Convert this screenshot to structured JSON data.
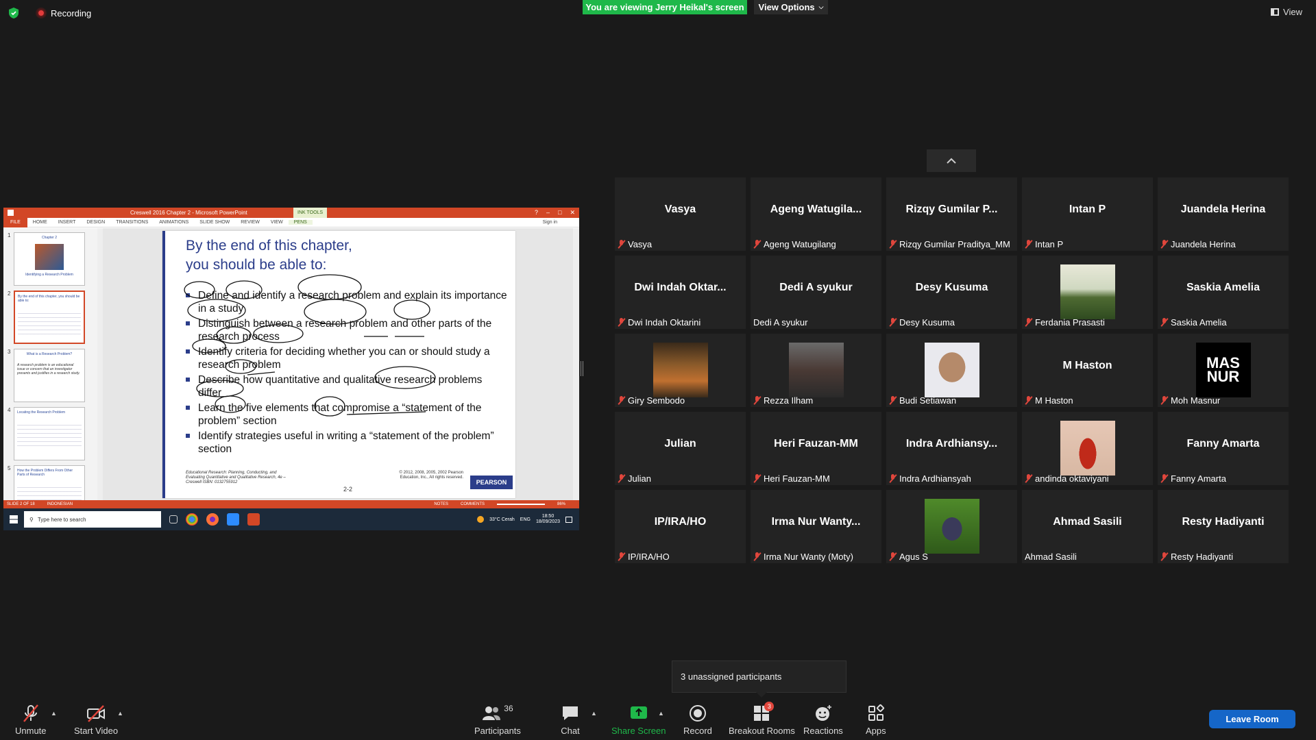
{
  "topbar": {
    "recording_label": "Recording",
    "viewing_banner": "You are viewing Jerry Heikal's screen",
    "view_options": "View Options",
    "view_label": "View"
  },
  "powerpoint": {
    "window_title": "Creswell 2016 Chapter 2 - Microsoft PowerPoint",
    "ink_tools": "INK TOOLS",
    "sign_in": "Sign in",
    "tabs": [
      "FILE",
      "HOME",
      "INSERT",
      "DESIGN",
      "TRANSITIONS",
      "ANIMATIONS",
      "SLIDE SHOW",
      "REVIEW",
      "VIEW",
      "PENS"
    ],
    "thumb_numbers": [
      "1",
      "2",
      "3",
      "4",
      "5"
    ],
    "thumbs": [
      {
        "title": "Chapter 2",
        "subtitle": "Identifying a Research Problem"
      },
      {
        "title": "By the end of this chapter, you should be able to:"
      },
      {
        "title": "What is a Research Problem?",
        "body": "A research problem is an educational issue or concern that an investigator presents and justifies in a research study."
      },
      {
        "title": "Locating the Research Problem"
      },
      {
        "title": "How the Problem Differs From Other Parts of Research"
      }
    ],
    "slide": {
      "title_line1": "By the end of this chapter,",
      "title_line2": "you should be able to:",
      "bullets": [
        "Define and identify a research problem and explain its importance in a study",
        "Distinguish between a research problem and other parts of the research process",
        "Identify criteria for deciding whether you can or should study a research problem",
        "Describe how quantitative and qualitative research problems differ",
        "Learn the five elements that compromise a “statement of the problem” section",
        "Identify strategies useful in writing a “statement of the problem” section"
      ],
      "footer_left": "Educational Research: Planning, Conducting, and Evaluating Quantitative and Qualitative Research, 4e – Creswell  ISBN: 0132755912",
      "page_number": "2-2",
      "footer_right": "© 2012, 2008, 2005, 2002 Pearson Education, Inc., All rights reserved.",
      "publisher": "PEARSON"
    },
    "status": {
      "slide_of": "SLIDE 2 OF 18",
      "language": "INDONESIAN",
      "notes": "NOTES",
      "comments": "COMMENTS",
      "zoom": "86%"
    },
    "taskbar": {
      "search_placeholder": "Type here to search",
      "weather": "33°C  Cerah",
      "lang": "ENG",
      "time": "18:50",
      "date": "18/09/2023"
    }
  },
  "participants": [
    {
      "big": "Vasya",
      "label": "Vasya",
      "muted": true
    },
    {
      "big": "Ageng Watugila...",
      "label": "Ageng Watugilang",
      "muted": true
    },
    {
      "big": "Rizqy Gumilar P...",
      "label": "Rizqy Gumilar Praditya_MM",
      "muted": true
    },
    {
      "big": "Intan P",
      "label": "Intan P",
      "muted": true
    },
    {
      "big": "Juandela Herina",
      "label": "Juandela Herina",
      "muted": true
    },
    {
      "big": "Dwi Indah Oktar...",
      "label": "Dwi Indah Oktarini",
      "muted": true
    },
    {
      "big": "Dedi A syukur",
      "label": "Dedi A syukur",
      "muted": false
    },
    {
      "big": "Desy Kusuma",
      "label": "Desy Kusuma",
      "muted": true
    },
    {
      "big": "",
      "label": "Ferdania Prasasti",
      "muted": true,
      "photo": "landscape"
    },
    {
      "big": "Saskia Amelia",
      "label": "Saskia Amelia",
      "muted": true
    },
    {
      "big": "",
      "label": "Giry Sembodo",
      "muted": true,
      "photo": "room"
    },
    {
      "big": "",
      "label": "Rezza Ilham",
      "muted": true,
      "photo": "piano"
    },
    {
      "big": "",
      "label": "Budi Setiawan",
      "muted": true,
      "photo": "mask"
    },
    {
      "big": "M Haston",
      "label": "M Haston",
      "muted": true
    },
    {
      "big": "",
      "label": "Moh Masnur",
      "muted": true,
      "photo": "logo",
      "logo_text": "MAS NUR"
    },
    {
      "big": "Julian",
      "label": "Julian",
      "muted": true
    },
    {
      "big": "Heri Fauzan-MM",
      "label": "Heri Fauzan-MM",
      "muted": true
    },
    {
      "big": "Indra Ardhiansy...",
      "label": "Indra Ardhiansyah",
      "muted": true
    },
    {
      "big": "",
      "label": "andinda oktaviyani",
      "muted": true,
      "photo": "girl"
    },
    {
      "big": "Fanny Amarta",
      "label": "Fanny Amarta",
      "muted": true
    },
    {
      "big": "IP/IRA/HO",
      "label": "IP/IRA/HO",
      "muted": true
    },
    {
      "big": "Irma Nur Wanty...",
      "label": "Irma Nur Wanty (Moty)",
      "muted": true
    },
    {
      "big": "",
      "label": "Agus S",
      "muted": true,
      "photo": "bike"
    },
    {
      "big": "Ahmad Sasili",
      "label": "Ahmad Sasili",
      "muted": false
    },
    {
      "big": "Resty Hadiyanti",
      "label": "Resty Hadiyanti",
      "muted": true
    }
  ],
  "unassigned": "3 unassigned participants",
  "toolbar": {
    "unmute": "Unmute",
    "start_video": "Start Video",
    "participants": "Participants",
    "participant_count": "36",
    "chat": "Chat",
    "share_screen": "Share Screen",
    "record": "Record",
    "breakout_rooms": "Breakout Rooms",
    "breakout_badge": "3",
    "reactions": "Reactions",
    "apps": "Apps",
    "leave": "Leave Room"
  },
  "colors": {
    "share_green": "#1fb84a",
    "ppt_orange": "#d24726",
    "slide_blue": "#2b3d8a",
    "leave_blue": "#1566c8",
    "mute_red": "#e0463c"
  }
}
